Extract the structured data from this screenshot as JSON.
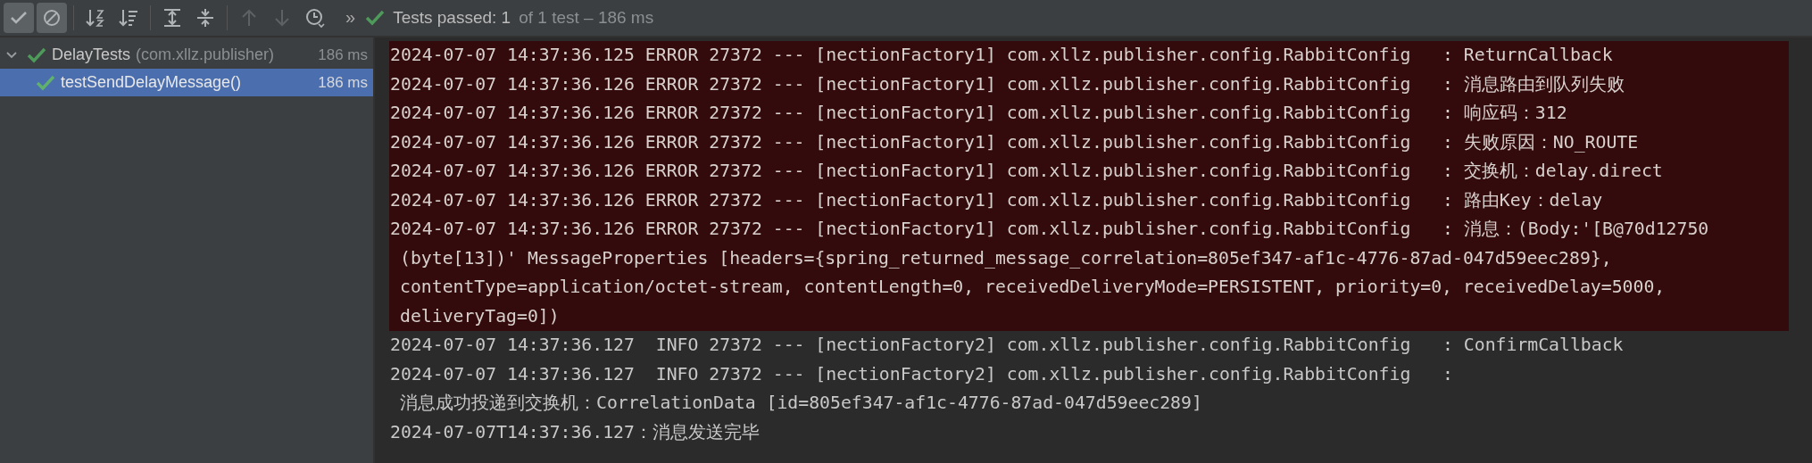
{
  "toolbar": {
    "buttons": [
      {
        "kind": "check",
        "selected": true,
        "disabled": false
      },
      {
        "kind": "cancel",
        "selected": true,
        "disabled": false
      },
      {
        "kind": "sort-alpha",
        "selected": false,
        "disabled": false
      },
      {
        "kind": "sort-duration",
        "selected": false,
        "disabled": false
      },
      {
        "kind": "expand",
        "selected": false,
        "disabled": false
      },
      {
        "kind": "collapse",
        "selected": false,
        "disabled": false
      },
      {
        "kind": "up",
        "selected": false,
        "disabled": true
      },
      {
        "kind": "down",
        "selected": false,
        "disabled": true
      },
      {
        "kind": "history",
        "selected": false,
        "disabled": false
      }
    ],
    "more": "»",
    "status": {
      "passed": true,
      "count": "Tests passed: 1",
      "detail": "of 1 test – 186 ms"
    }
  },
  "tree": [
    {
      "name": "DelayTests",
      "package": "(com.xllz.publisher)",
      "time": "186 ms",
      "passed": true,
      "expanded": true,
      "selected": false,
      "children": [
        {
          "name": "testSendDelayMessage()",
          "time": "186 ms",
          "passed": true,
          "selected": true
        }
      ]
    }
  ],
  "console": [
    {
      "kind": "error",
      "lines": [
        "2024-07-07 14:37:36.125 ERROR 27372 --- [nectionFactory1] com.xllz.publisher.config.RabbitConfig   : ReturnCallback"
      ]
    },
    {
      "kind": "error",
      "lines": [
        "2024-07-07 14:37:36.126 ERROR 27372 --- [nectionFactory1] com.xllz.publisher.config.RabbitConfig   : 消息路由到队列失败"
      ]
    },
    {
      "kind": "error",
      "lines": [
        "2024-07-07 14:37:36.126 ERROR 27372 --- [nectionFactory1] com.xllz.publisher.config.RabbitConfig   : 响应码：312"
      ]
    },
    {
      "kind": "error",
      "lines": [
        "2024-07-07 14:37:36.126 ERROR 27372 --- [nectionFactory1] com.xllz.publisher.config.RabbitConfig   : 失败原因：NO_ROUTE"
      ]
    },
    {
      "kind": "error",
      "lines": [
        "2024-07-07 14:37:36.126 ERROR 27372 --- [nectionFactory1] com.xllz.publisher.config.RabbitConfig   : 交换机：delay.direct"
      ]
    },
    {
      "kind": "error",
      "lines": [
        "2024-07-07 14:37:36.126 ERROR 27372 --- [nectionFactory1] com.xllz.publisher.config.RabbitConfig   : 路由Key：delay"
      ]
    },
    {
      "kind": "error",
      "lines": [
        "2024-07-07 14:37:36.126 ERROR 27372 --- [nectionFactory1] com.xllz.publisher.config.RabbitConfig   : 消息：(Body:'[B@70d12750",
        "(byte[13])' MessageProperties [headers={spring_returned_message_correlation=805ef347-af1c-4776-87ad-047d59eec289},",
        "contentType=application/octet-stream, contentLength=0, receivedDeliveryMode=PERSISTENT, priority=0, receivedDelay=5000,",
        "deliveryTag=0])"
      ]
    },
    {
      "kind": "info",
      "lines": [
        "2024-07-07 14:37:36.127  INFO 27372 --- [nectionFactory2] com.xllz.publisher.config.RabbitConfig   : ConfirmCallback"
      ]
    },
    {
      "kind": "info",
      "lines": [
        "2024-07-07 14:37:36.127  INFO 27372 --- [nectionFactory2] com.xllz.publisher.config.RabbitConfig   :",
        "消息成功投递到交换机：CorrelationData [id=805ef347-af1c-4776-87ad-047d59eec289]"
      ]
    },
    {
      "kind": "plain",
      "lines": [
        "2024-07-07T14:37:36.127：消息发送完毕"
      ]
    }
  ]
}
